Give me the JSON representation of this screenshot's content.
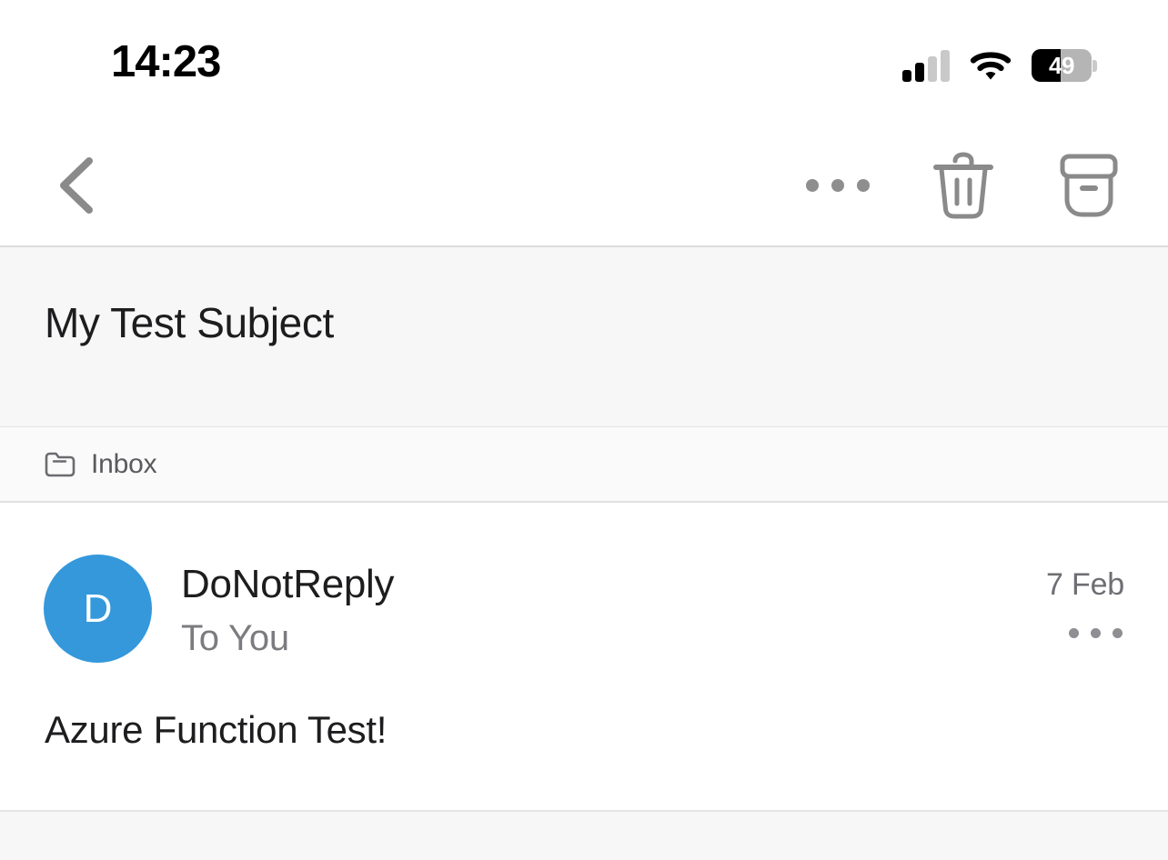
{
  "status_bar": {
    "time": "14:23",
    "battery_level": "49",
    "battery_percent": 49,
    "signal_icon": "cellular-signal-icon",
    "wifi_icon": "wifi-icon",
    "battery_icon": "battery-icon"
  },
  "toolbar": {
    "back_icon": "chevron-left-icon",
    "more_icon": "more-options-icon",
    "delete_icon": "trash-icon",
    "archive_icon": "archive-icon"
  },
  "subject": {
    "text": "My Test Subject"
  },
  "folder": {
    "icon": "folder-icon",
    "label": "Inbox"
  },
  "message": {
    "avatar_initial": "D",
    "avatar_color": "#3498db",
    "sender": "DoNotReply",
    "recipients": "To You",
    "date": "7 Feb",
    "more_icon": "more-options-icon",
    "body": "Azure Function Test!"
  }
}
